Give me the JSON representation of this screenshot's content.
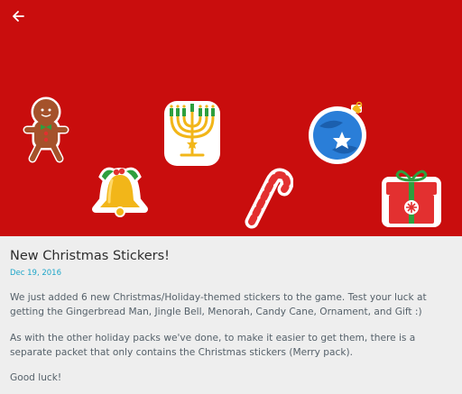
{
  "header": {
    "back_icon": "arrow-left-icon"
  },
  "hero": {
    "background_color": "#c90d0d",
    "stickers": [
      "gingerbread-man-icon",
      "jingle-bell-icon",
      "menorah-icon",
      "candy-cane-icon",
      "ornament-icon",
      "gift-icon"
    ]
  },
  "post": {
    "title": "New Christmas Stickers!",
    "date": "Dec 19, 2016",
    "paragraphs": [
      "We just added 6 new Christmas/Holiday-themed stickers to the game. Test your luck at getting the Gingerbread Man, Jingle Bell, Menorah, Candy Cane, Ornament, and Gift :)",
      "As with the other holiday packs we've done, to make it easier to get them, there is a separate packet that only contains the Christmas stickers (Merry pack).",
      "Good luck!"
    ]
  },
  "colors": {
    "date": "#1fa6c9",
    "title": "#2d2d2d",
    "body_text": "#55616a",
    "page_background": "#eeeeee"
  }
}
